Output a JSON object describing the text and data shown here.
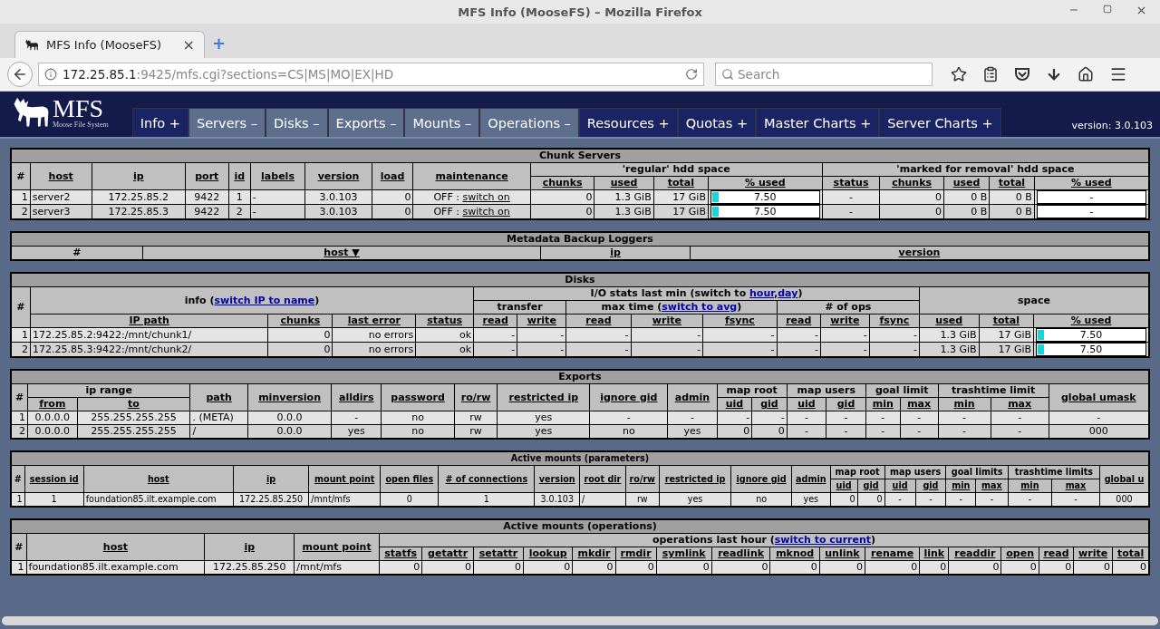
{
  "window": {
    "title": "MFS Info (MooseFS) – Mozilla Firefox"
  },
  "browser": {
    "tab": {
      "title": "MFS Info (MooseFS)",
      "close": "×"
    },
    "new_tab": "+",
    "url": {
      "host": "172.25.85.1",
      "rest": ":9425/mfs.cgi?sections=CS|MS|MO|EX|HD"
    },
    "search": {
      "placeholder": "Search"
    }
  },
  "app": {
    "logo": "MFS",
    "logo_sub": "Moose File System",
    "version": "version: 3.0.103",
    "nav": [
      {
        "label": "Info +",
        "expanded": false
      },
      {
        "label": "Servers –",
        "expanded": true
      },
      {
        "label": "Disks –",
        "expanded": true
      },
      {
        "label": "Exports –",
        "expanded": true
      },
      {
        "label": "Mounts –",
        "expanded": true
      },
      {
        "label": "Operations –",
        "expanded": true
      },
      {
        "label": "Resources +",
        "expanded": false
      },
      {
        "label": "Quotas +",
        "expanded": false
      },
      {
        "label": "Master Charts +",
        "expanded": false
      },
      {
        "label": "Server Charts +",
        "expanded": false
      }
    ]
  },
  "sections": [
    {
      "kind": "chunk_servers",
      "title": "Chunk Servers",
      "header": [
        [
          {
            "text": "#",
            "rowspan": 2
          },
          {
            "text": "host",
            "rowspan": 2,
            "sort": true
          },
          {
            "text": "ip",
            "rowspan": 2,
            "sort": true
          },
          {
            "text": "port",
            "rowspan": 2,
            "sort": true
          },
          {
            "text": "id",
            "rowspan": 2,
            "sort": true
          },
          {
            "text": "labels",
            "rowspan": 2,
            "sort": true
          },
          {
            "text": "version",
            "rowspan": 2,
            "sort": true
          },
          {
            "text": "load",
            "rowspan": 2,
            "sort": true
          },
          {
            "text": "maintenance",
            "rowspan": 2,
            "sort": true
          },
          {
            "text": "'regular' hdd space",
            "colspan": 4
          },
          {
            "text": "'marked for removal' hdd space",
            "colspan": 5
          }
        ],
        [
          {
            "text": "chunks",
            "sort": true
          },
          {
            "text": "used",
            "sort": true
          },
          {
            "text": "total",
            "sort": true
          },
          {
            "text": "% used",
            "sort": true
          },
          {
            "text": "status",
            "sort": true
          },
          {
            "text": "chunks",
            "sort": true
          },
          {
            "text": "used",
            "sort": true
          },
          {
            "text": "total",
            "sort": true
          },
          {
            "text": "% used",
            "sort": true
          }
        ]
      ],
      "rows": [
        [
          "1",
          "server2",
          "172.25.85.2",
          "9422",
          "1",
          "-",
          "3.0.103",
          "0",
          {
            "parts": [
              {
                "text": "OFF : "
              },
              {
                "link": "switch on"
              }
            ]
          },
          "0",
          "1.3 GiB",
          "17 GiB",
          {
            "kind": "bar",
            "text": "7.50",
            "level": 0.075
          },
          "-",
          "0",
          "0 B",
          "0 B",
          {
            "kind": "bar",
            "text": "-"
          }
        ],
        [
          "2",
          "server3",
          "172.25.85.3",
          "9422",
          "2",
          "-",
          "3.0.103",
          "0",
          {
            "parts": [
              {
                "text": "OFF : "
              },
              {
                "link": "switch on"
              }
            ]
          },
          "0",
          "1.3 GiB",
          "17 GiB",
          {
            "kind": "bar",
            "text": "7.50",
            "level": 0.075
          },
          "-",
          "0",
          "0 B",
          "0 B",
          {
            "kind": "bar",
            "text": "-"
          }
        ]
      ]
    },
    {
      "kind": "loggers",
      "title": "Metadata Backup Loggers",
      "header": [
        [
          {
            "text": "#"
          },
          {
            "text": "host ▼",
            "sort": true
          },
          {
            "text": "ip",
            "sort": true
          },
          {
            "text": "version",
            "sort": true
          }
        ]
      ]
    },
    {
      "kind": "disks",
      "title": "Disks",
      "header": [
        [
          {
            "text": "#",
            "rowspan": 3
          },
          {
            "parts": [
              {
                "text": "info ("
              },
              {
                "link": "switch IP to name"
              },
              {
                "text": ")"
              }
            ],
            "colspan": 4,
            "rowspan": 2
          },
          {
            "parts": [
              {
                "text": "I/O stats last min (switch to "
              },
              {
                "link": "hour"
              },
              {
                "text": ","
              },
              {
                "link": "day"
              },
              {
                "text": ")"
              }
            ],
            "colspan": 8
          },
          {
            "text": "space",
            "colspan": 3,
            "rowspan": 2
          }
        ],
        [
          {
            "text": "transfer",
            "colspan": 2
          },
          {
            "parts": [
              {
                "text": "max time ("
              },
              {
                "link": "switch to avg"
              },
              {
                "text": ")"
              }
            ],
            "colspan": 3
          },
          {
            "text": "# of ops",
            "colspan": 3
          }
        ],
        [
          {
            "text": "IP path",
            "sort": true
          },
          {
            "text": "chunks",
            "sort": true
          },
          {
            "text": "last error",
            "sort": true
          },
          {
            "text": "status",
            "sort": true
          },
          {
            "text": "read",
            "sort": true
          },
          {
            "text": "write",
            "sort": true
          },
          {
            "text": "read",
            "sort": true
          },
          {
            "text": "write",
            "sort": true
          },
          {
            "text": "fsync",
            "sort": true
          },
          {
            "text": "read",
            "sort": true
          },
          {
            "text": "write",
            "sort": true
          },
          {
            "text": "fsync",
            "sort": true
          },
          {
            "text": "used",
            "sort": true
          },
          {
            "text": "total",
            "sort": true
          },
          {
            "text": "% used",
            "sort": true
          }
        ]
      ],
      "rows": [
        [
          "1",
          "172.25.85.2:9422:/mnt/chunk1/",
          "0",
          "no errors",
          "ok",
          "-",
          "-",
          "-",
          "-",
          "-",
          "-",
          "-",
          "-",
          "1.3 GiB",
          "17 GiB",
          {
            "kind": "bar",
            "text": "7.50",
            "level": 0.075
          }
        ],
        [
          "2",
          "172.25.85.3:9422:/mnt/chunk2/",
          "0",
          "no errors",
          "ok",
          "-",
          "-",
          "-",
          "-",
          "-",
          "-",
          "-",
          "-",
          "1.3 GiB",
          "17 GiB",
          {
            "kind": "bar",
            "text": "7.50",
            "level": 0.075
          }
        ]
      ]
    },
    {
      "kind": "exports",
      "title": "Exports",
      "header": [
        [
          {
            "text": "#",
            "rowspan": 2
          },
          {
            "text": "ip range",
            "colspan": 2
          },
          {
            "text": "path",
            "rowspan": 2,
            "sort": true
          },
          {
            "text": "minversion",
            "rowspan": 2,
            "sort": true
          },
          {
            "text": "alldirs",
            "rowspan": 2,
            "sort": true
          },
          {
            "text": "password",
            "rowspan": 2,
            "sort": true
          },
          {
            "text": "ro/rw",
            "rowspan": 2,
            "sort": true
          },
          {
            "text": "restricted ip",
            "rowspan": 2,
            "sort": true
          },
          {
            "text": "ignore gid",
            "rowspan": 2,
            "sort": true
          },
          {
            "text": "admin",
            "rowspan": 2,
            "sort": true
          },
          {
            "text": "map root",
            "colspan": 2
          },
          {
            "text": "map users",
            "colspan": 2
          },
          {
            "text": "goal limit",
            "colspan": 2
          },
          {
            "text": "trashtime limit",
            "colspan": 2
          },
          {
            "text": "global umask",
            "rowspan": 2,
            "sort": true
          }
        ],
        [
          {
            "text": "from",
            "sort": true
          },
          {
            "text": "to",
            "sort": true
          },
          {
            "text": "uid",
            "sort": true
          },
          {
            "text": "gid",
            "sort": true
          },
          {
            "text": "uid",
            "sort": true
          },
          {
            "text": "gid",
            "sort": true
          },
          {
            "text": "min",
            "sort": true
          },
          {
            "text": "max",
            "sort": true
          },
          {
            "text": "min",
            "sort": true
          },
          {
            "text": "max",
            "sort": true
          }
        ]
      ],
      "rows": [
        [
          "1",
          "0.0.0.0",
          "255.255.255.255",
          ". (META)",
          "0.0.0",
          "-",
          "no",
          "rw",
          "yes",
          "-",
          "-",
          "-",
          "-",
          "-",
          "-",
          "-",
          "-",
          "-",
          "-",
          "-"
        ],
        [
          "2",
          "0.0.0.0",
          "255.255.255.255",
          "/",
          "0.0.0",
          "yes",
          "no",
          "rw",
          "yes",
          "no",
          "yes",
          "0",
          "0",
          "-",
          "-",
          "-",
          "-",
          "-",
          "-",
          "000"
        ]
      ]
    },
    {
      "kind": "mount_params",
      "title": "Active mounts (parameters)",
      "header": [
        [
          {
            "text": "#",
            "rowspan": 2
          },
          {
            "text": "session id",
            "rowspan": 2,
            "sort": true
          },
          {
            "text": "host",
            "rowspan": 2,
            "sort": true
          },
          {
            "text": "ip",
            "rowspan": 2,
            "sort": true
          },
          {
            "text": "mount point",
            "rowspan": 2,
            "sort": true
          },
          {
            "text": "open files",
            "rowspan": 2,
            "sort": true
          },
          {
            "text": "# of connections",
            "rowspan": 2,
            "sort": true
          },
          {
            "text": "version",
            "rowspan": 2,
            "sort": true
          },
          {
            "text": "root dir",
            "rowspan": 2,
            "sort": true
          },
          {
            "text": "ro/rw",
            "rowspan": 2,
            "sort": true
          },
          {
            "text": "restricted ip",
            "rowspan": 2,
            "sort": true
          },
          {
            "text": "ignore gid",
            "rowspan": 2,
            "sort": true
          },
          {
            "text": "admin",
            "rowspan": 2,
            "sort": true
          },
          {
            "text": "map root",
            "colspan": 2
          },
          {
            "text": "map users",
            "colspan": 2
          },
          {
            "text": "goal limits",
            "colspan": 2
          },
          {
            "text": "trashtime limits",
            "colspan": 2
          },
          {
            "text": "global u",
            "rowspan": 2,
            "sort": true
          }
        ],
        [
          {
            "text": "uid",
            "sort": true
          },
          {
            "text": "gid",
            "sort": true
          },
          {
            "text": "uid",
            "sort": true
          },
          {
            "text": "gid",
            "sort": true
          },
          {
            "text": "min",
            "sort": true
          },
          {
            "text": "max",
            "sort": true
          },
          {
            "text": "min",
            "sort": true
          },
          {
            "text": "max",
            "sort": true
          }
        ]
      ],
      "rows": [
        [
          "1",
          "1",
          "foundation85.ilt.example.com",
          "172.25.85.250",
          "/mnt/mfs",
          "0",
          "1",
          "3.0.103",
          "/",
          "rw",
          "yes",
          "no",
          "yes",
          "0",
          "0",
          "-",
          "-",
          "-",
          "-",
          "-",
          "-",
          "000"
        ]
      ]
    },
    {
      "kind": "mount_ops",
      "title": "Active mounts (operations)",
      "header": [
        [
          {
            "text": "#",
            "rowspan": 2
          },
          {
            "text": "host",
            "rowspan": 2,
            "sort": true
          },
          {
            "text": "ip",
            "rowspan": 2,
            "sort": true
          },
          {
            "text": "mount point",
            "rowspan": 2,
            "sort": true
          },
          {
            "parts": [
              {
                "text": "operations last hour ("
              },
              {
                "link": "switch to current"
              },
              {
                "text": ")"
              }
            ],
            "colspan": 17
          }
        ],
        [
          {
            "text": "statfs",
            "sort": true
          },
          {
            "text": "getattr",
            "sort": true
          },
          {
            "text": "setattr",
            "sort": true
          },
          {
            "text": "lookup",
            "sort": true
          },
          {
            "text": "mkdir",
            "sort": true
          },
          {
            "text": "rmdir",
            "sort": true
          },
          {
            "text": "symlink",
            "sort": true
          },
          {
            "text": "readlink",
            "sort": true
          },
          {
            "text": "mknod",
            "sort": true
          },
          {
            "text": "unlink",
            "sort": true
          },
          {
            "text": "rename",
            "sort": true
          },
          {
            "text": "link",
            "sort": true
          },
          {
            "text": "readdir",
            "sort": true
          },
          {
            "text": "open",
            "sort": true
          },
          {
            "text": "read",
            "sort": true
          },
          {
            "text": "write",
            "sort": true
          },
          {
            "text": "total",
            "sort": true
          }
        ]
      ],
      "rows": [
        [
          "1",
          "foundation85.ilt.example.com",
          "172.25.85.250",
          "/mnt/mfs",
          "0",
          "0",
          "0",
          "0",
          "0",
          "0",
          "0",
          "0",
          "0",
          "0",
          "0",
          "0",
          "0",
          "0",
          "0",
          "0",
          "0"
        ]
      ]
    }
  ]
}
